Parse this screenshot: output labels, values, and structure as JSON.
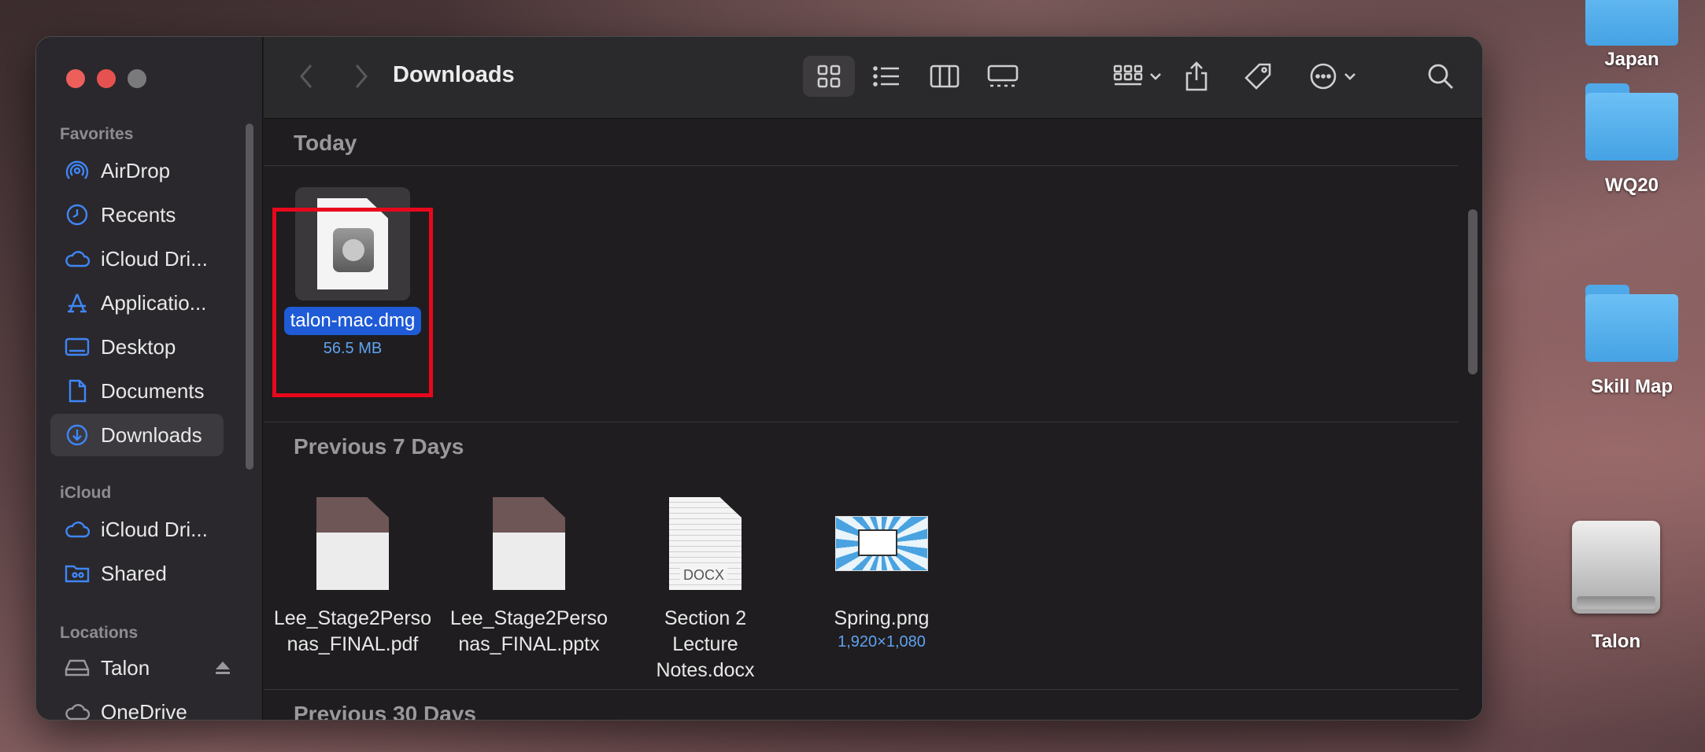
{
  "desktop": {
    "icons": [
      {
        "label": "Japan"
      },
      {
        "label": "WQ20"
      },
      {
        "label": "Skill Map"
      },
      {
        "label": "Talon"
      }
    ]
  },
  "window": {
    "title": "Downloads",
    "traffic_colors": {
      "close": "#ec5f5b",
      "minimize": "#e6a43b",
      "zoom": "#7a7a7c"
    }
  },
  "sidebar": {
    "favorites_label": "Favorites",
    "favorites": [
      {
        "label": "AirDrop",
        "icon": "airdrop-icon"
      },
      {
        "label": "Recents",
        "icon": "clock-icon"
      },
      {
        "label": "iCloud Dri...",
        "icon": "cloud-icon"
      },
      {
        "label": "Applicatio...",
        "icon": "applications-icon"
      },
      {
        "label": "Desktop",
        "icon": "desktop-icon"
      },
      {
        "label": "Documents",
        "icon": "document-icon"
      },
      {
        "label": "Downloads",
        "icon": "download-icon",
        "active": true
      }
    ],
    "icloud_label": "iCloud",
    "icloud": [
      {
        "label": "iCloud Dri...",
        "icon": "cloud-icon"
      },
      {
        "label": "Shared",
        "icon": "shared-folder-icon"
      }
    ],
    "locations_label": "Locations",
    "locations": [
      {
        "label": "Talon",
        "icon": "drive-icon"
      },
      {
        "label": "OneDrive",
        "icon": "cloud-icon"
      }
    ],
    "accent_color": "#3f86f7"
  },
  "groups": {
    "today": {
      "label": "Today"
    },
    "prev7": {
      "label": "Previous 7 Days"
    },
    "prev30": {
      "label": "Previous 30 Days"
    }
  },
  "files": {
    "dmg": {
      "name": "talon-mac.dmg",
      "meta": "56.5 MB",
      "selected": true
    },
    "pdf": {
      "name": "Lee_Stage2Personas_FINAL.pdf"
    },
    "pptx": {
      "name": "Lee_Stage2Personas_FINAL.pptx"
    },
    "docx": {
      "name": "Section 2 Lecture Notes.docx",
      "badge": "DOCX"
    },
    "png": {
      "name": "Spring.png",
      "meta": "1,920×1,080"
    }
  }
}
